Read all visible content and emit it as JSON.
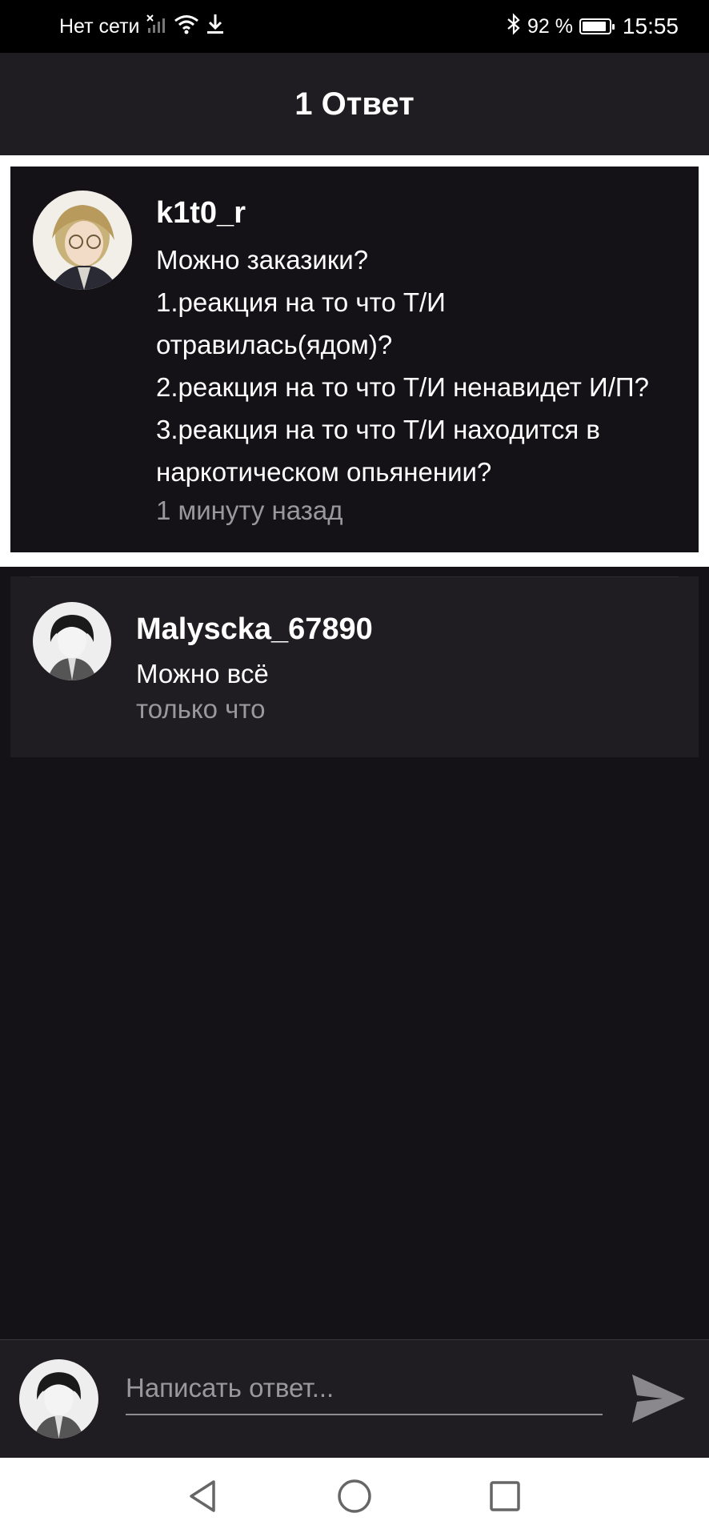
{
  "status_bar": {
    "network_text": "Нет сети",
    "battery_percent": "92 %",
    "battery_level": 0.92,
    "time": "15:55",
    "icons": [
      "signal-icon",
      "wifi-icon",
      "download-icon",
      "bluetooth-icon",
      "battery-icon"
    ]
  },
  "header": {
    "title": "1 Ответ"
  },
  "original_comment": {
    "username": "k1t0_r",
    "lines": [
      "Можно заказики?",
      "1.реакция на то что Т/И",
      "отравилась(ядом)?",
      "2.реакция на то что Т/И ненавидет И/П?",
      "3.реакция на то что Т/И находится в",
      "наркотическом опьянении?"
    ],
    "timestamp": "1 минуту назад"
  },
  "reply": {
    "username": "Malyscka_67890",
    "text": "Можно всё",
    "timestamp": "только что"
  },
  "composer": {
    "placeholder": "Написать ответ...",
    "value": ""
  },
  "colors": {
    "background": "#141216",
    "card": "#1f1d21",
    "secondary_text": "#9a989c",
    "send_icon": "#8a888d"
  },
  "nav_bar": {
    "icons": [
      "back-icon",
      "home-icon",
      "recents-icon"
    ]
  }
}
